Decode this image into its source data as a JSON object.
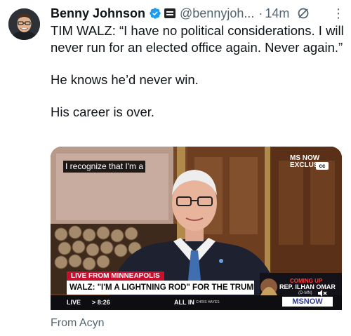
{
  "tweet": {
    "author_name": "Benny Johnson",
    "handle": "@bennyjoh...",
    "separator": "·",
    "timestamp": "14m",
    "more_label": "⋮",
    "text_paragraphs": [
      "TIM WALZ: “I have no political considerations. I will never run for an elected office again. Never again.”",
      "He knows he’d never win.",
      "His career is over."
    ],
    "attribution": "From Acyn"
  },
  "video": {
    "caption": "I recognize that I'm a",
    "network_label": "MS NOW",
    "exclusive_label": "EXCLUS",
    "cc_label": "cc",
    "live_tag": "LIVE FROM MINNEAPOLIS",
    "headline": "WALZ: \"I'M A LIGHTNING ROD\" FOR THE TRUMP ADMIN",
    "ticker_live": "LIVE",
    "ticker_time": "> 8:26",
    "ticker_program": "ALL IN",
    "ticker_host": "CHRIS HAYES",
    "coming_up": "COMING UP",
    "coming_up_name": "REP. ILHAN OMAR",
    "coming_up_party": "(D-MN)",
    "network_logo_text": "MSNOW"
  },
  "icons": [
    "verified-badge-icon",
    "affiliation-badge-icon",
    "grok-icon",
    "more-icon",
    "mute-icon"
  ],
  "colors": {
    "verified_blue": "#1d9bf0",
    "secondary_text": "#536471",
    "primary_text": "#0f1419",
    "live_red": "#c8102e"
  }
}
